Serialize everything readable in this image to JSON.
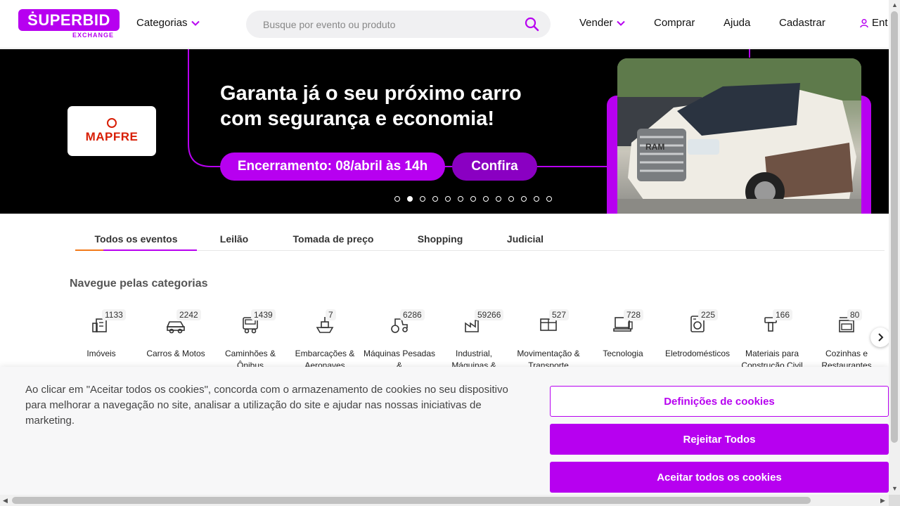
{
  "header": {
    "logo_text": "ṠUPERBID",
    "logo_sub": "EXCHANGE",
    "categories_label": "Categorias",
    "search_placeholder": "Busque por evento ou produto",
    "nav": {
      "sell": "Vender",
      "buy": "Comprar",
      "help": "Ajuda",
      "register": "Cadastrar",
      "login": "Ent"
    }
  },
  "banner": {
    "brand": "MAPFRE",
    "headline_line1": "Garanta já o seu próximo carro",
    "headline_line2": "com segurança e economia!",
    "closing": "Encerramento: 08/abril às 14h",
    "cta": "Confira",
    "slide_count": 13,
    "active_slide": 2
  },
  "tabs": [
    {
      "label": "Todos os eventos",
      "active": true
    },
    {
      "label": "Leilão",
      "active": false
    },
    {
      "label": "Tomada de preço",
      "active": false
    },
    {
      "label": "Shopping",
      "active": false
    },
    {
      "label": "Judicial",
      "active": false
    }
  ],
  "categories_title": "Navegue pelas categorias",
  "categories": [
    {
      "label": "Imóveis",
      "count": "1133",
      "icon": "building-icon"
    },
    {
      "label": "Carros & Motos",
      "count": "2242",
      "icon": "car-icon"
    },
    {
      "label": "Caminhões & Ônibus",
      "count": "1439",
      "icon": "truck-icon"
    },
    {
      "label": "Embarcações & Aeronaves",
      "count": "7",
      "icon": "boat-icon"
    },
    {
      "label": "Máquinas Pesadas &",
      "count": "6286",
      "icon": "tractor-icon"
    },
    {
      "label": "Industrial, Máquinas &",
      "count": "59266",
      "icon": "factory-icon"
    },
    {
      "label": "Movimentação & Transporte",
      "count": "527",
      "icon": "container-icon"
    },
    {
      "label": "Tecnologia",
      "count": "728",
      "icon": "computer-icon"
    },
    {
      "label": "Eletrodomésticos",
      "count": "225",
      "icon": "washer-icon"
    },
    {
      "label": "Materiais para Construção Civil",
      "count": "166",
      "icon": "drill-icon"
    },
    {
      "label": "Cozinhas e Restaurantes",
      "count": "80",
      "icon": "stove-icon"
    }
  ],
  "cookie": {
    "text": "Ao clicar em \"Aceitar todos os cookies\", concorda com o armazenamento de cookies no seu dispositivo para melhorar a navegação no site, analisar a utilização do site e ajudar nas nossas iniciativas de marketing.",
    "settings": "Definições de cookies",
    "reject": "Rejeitar Todos",
    "accept": "Aceitar todos os cookies"
  },
  "colors": {
    "brand": "#b700f0",
    "accent_underline": "#f27a1a"
  }
}
